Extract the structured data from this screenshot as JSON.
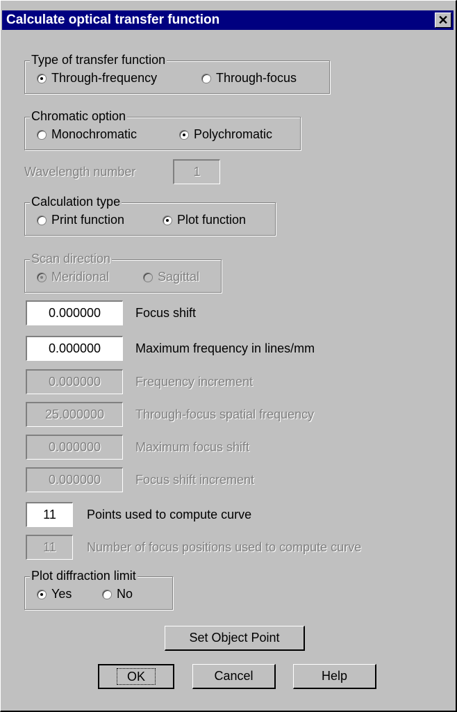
{
  "window": {
    "title": "Calculate optical transfer function",
    "close_glyph": "✕"
  },
  "transfer_type": {
    "legend": "Type of transfer function",
    "options": [
      "Through-frequency",
      "Through-focus"
    ],
    "selected": "Through-frequency"
  },
  "chromatic": {
    "legend": "Chromatic option",
    "options": [
      "Monochromatic",
      "Polychromatic"
    ],
    "selected": "Polychromatic"
  },
  "wavelength": {
    "label": "Wavelength number",
    "value": "1",
    "enabled": false
  },
  "calc_type": {
    "legend": "Calculation type",
    "options": [
      "Print function",
      "Plot function"
    ],
    "selected": "Plot function"
  },
  "scan": {
    "legend": "Scan direction",
    "options": [
      "Meridional",
      "Sagittal"
    ],
    "selected": "Meridional",
    "enabled": false
  },
  "fields": [
    {
      "value": "0.000000",
      "label": "Focus shift",
      "enabled": true
    },
    {
      "value": "0.000000",
      "label": "Maximum frequency in lines/mm",
      "enabled": true
    },
    {
      "value": "0.000000",
      "label": "Frequency increment",
      "enabled": false
    },
    {
      "value": "25.000000",
      "label": "Through-focus spatial frequency",
      "enabled": false
    },
    {
      "value": "0.000000",
      "label": "Maximum focus shift",
      "enabled": false
    },
    {
      "value": "0.000000",
      "label": "Focus shift increment",
      "enabled": false
    }
  ],
  "points": {
    "value": "11",
    "label": "Points used to compute curve",
    "enabled": true
  },
  "focus_positions": {
    "value": "11",
    "label": "Number of focus positions used to compute curve",
    "enabled": false
  },
  "diffraction": {
    "legend": "Plot diffraction limit",
    "options": [
      "Yes",
      "No"
    ],
    "selected": "Yes"
  },
  "buttons": {
    "set_object_point": "Set Object Point",
    "ok": "OK",
    "cancel": "Cancel",
    "help": "Help"
  }
}
